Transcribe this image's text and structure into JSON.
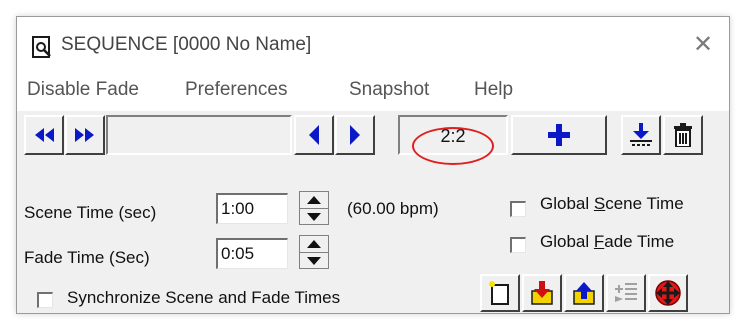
{
  "window": {
    "title": "SEQUENCE [0000 No Name]",
    "app_icon": "document-magnifier-icon",
    "close_glyph": "✕"
  },
  "menu": {
    "items": [
      "Disable Fade",
      "Preferences",
      "Snapshot",
      "Help"
    ]
  },
  "toolbar": {
    "rewind_icon": "rewind-icon",
    "fast_forward_icon": "fast-forward-icon",
    "name_field": "",
    "prev_icon": "step-back-icon",
    "next_icon": "step-forward-icon",
    "counter": "2:2",
    "add_icon": "add-icon",
    "import_icon": "import-down-icon",
    "delete_icon": "trash-icon",
    "annotation_color": "#e02020"
  },
  "form": {
    "scene_time_label": "Scene Time (sec)",
    "scene_time_value": "1:00",
    "bpm": "(60.00 bpm)",
    "fade_time_label": "Fade Time (Sec)",
    "fade_time_value": "0:05",
    "sync_label": "Synchronize Scene and Fade Times",
    "sync_checked": false,
    "global_scene_label_pre": "Global ",
    "global_scene_label_key": "S",
    "global_scene_label_post": "cene Time",
    "global_scene_checked": false,
    "global_fade_label_pre": "Global ",
    "global_fade_label_key": "F",
    "global_fade_label_post": "ade Time",
    "global_fade_checked": false
  },
  "bottom_buttons": {
    "icons": [
      "new-scene-icon",
      "move-down-icon",
      "move-up-icon",
      "insert-list-icon",
      "move-all-icon"
    ]
  }
}
